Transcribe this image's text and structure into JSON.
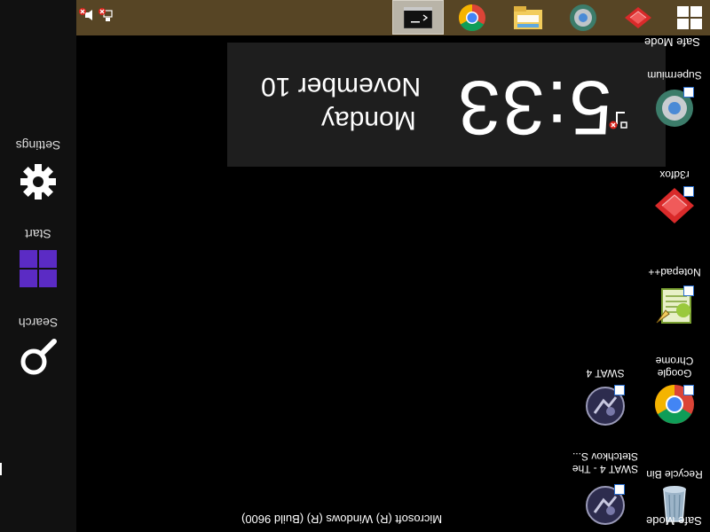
{
  "taskbar": {
    "background": "#574525",
    "items": [
      {
        "name": "command-prompt",
        "icon": "cmd-icon",
        "active": true
      },
      {
        "name": "google-chrome",
        "icon": "chrome-icon",
        "active": false
      },
      {
        "name": "file-explorer",
        "icon": "folder-icon",
        "active": false
      },
      {
        "name": "supermium",
        "icon": "supermium-icon",
        "active": false
      },
      {
        "name": "r3dfox",
        "icon": "r3dfox-icon",
        "active": false
      },
      {
        "name": "start",
        "icon": "windows-logo-icon",
        "active": false
      }
    ],
    "tray": [
      "volume-muted-icon",
      "network-error-icon"
    ]
  },
  "charms": {
    "items": [
      {
        "label": "Settings",
        "icon": "gear-icon"
      },
      {
        "label": "Start",
        "icon": "windows-logo-icon",
        "color": "#5b2bc4"
      },
      {
        "label": "Search",
        "icon": "search-icon"
      }
    ]
  },
  "clock": {
    "time": "5:33",
    "day": "Monday",
    "date": "November 10",
    "network_icon": "network-disconnected-icon"
  },
  "desktop": {
    "icons": [
      {
        "label": "Supermium",
        "icon": "supermium-icon"
      },
      {
        "label": "r3dfox",
        "icon": "r3dfox-icon"
      },
      {
        "label": "Notepad++",
        "icon": "notepad-plus-plus-icon"
      },
      {
        "label": "Google\nChrome",
        "icon": "chrome-icon"
      },
      {
        "label": "Recycle Bin",
        "icon": "recycle-bin-icon"
      },
      {
        "label": "SWAT 4",
        "icon": "swat4-icon"
      },
      {
        "label": "SWAT 4 - The\nStetchkov S...",
        "icon": "swat4-icon"
      }
    ],
    "safe_mode_label": "Safe Mode",
    "watermark": "Microsoft (R) Windows (R) (Build 9600)"
  }
}
